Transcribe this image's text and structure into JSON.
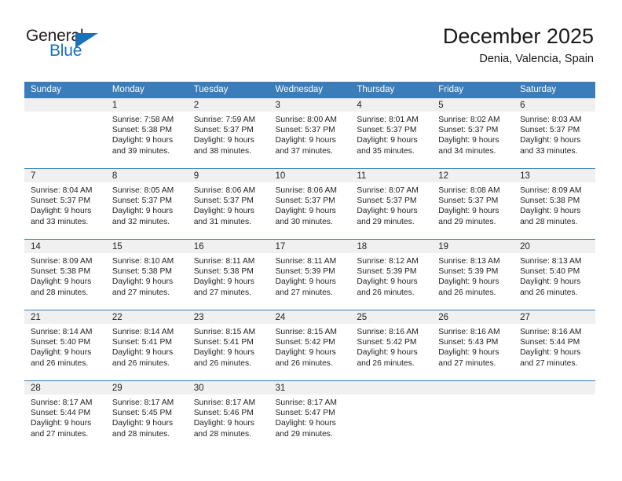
{
  "logo": {
    "word_one": "General",
    "word_two": "Blue",
    "triangle_icon": "triangle-icon",
    "brand_color": "#1b71b8"
  },
  "header": {
    "title": "December 2025",
    "subtitle": "Denia, Valencia, Spain"
  },
  "theme": {
    "header_blue": "#3b7dba",
    "daynum_band": "#f0f0f0",
    "text": "#222222"
  },
  "weekday_headers": [
    "Sunday",
    "Monday",
    "Tuesday",
    "Wednesday",
    "Thursday",
    "Friday",
    "Saturday"
  ],
  "weeks": [
    [
      {
        "day": "",
        "sunrise": "",
        "sunset": "",
        "daylight_line1": "",
        "daylight_line2": ""
      },
      {
        "day": "1",
        "sunrise": "Sunrise: 7:58 AM",
        "sunset": "Sunset: 5:38 PM",
        "daylight_line1": "Daylight: 9 hours",
        "daylight_line2": "and 39 minutes."
      },
      {
        "day": "2",
        "sunrise": "Sunrise: 7:59 AM",
        "sunset": "Sunset: 5:37 PM",
        "daylight_line1": "Daylight: 9 hours",
        "daylight_line2": "and 38 minutes."
      },
      {
        "day": "3",
        "sunrise": "Sunrise: 8:00 AM",
        "sunset": "Sunset: 5:37 PM",
        "daylight_line1": "Daylight: 9 hours",
        "daylight_line2": "and 37 minutes."
      },
      {
        "day": "4",
        "sunrise": "Sunrise: 8:01 AM",
        "sunset": "Sunset: 5:37 PM",
        "daylight_line1": "Daylight: 9 hours",
        "daylight_line2": "and 35 minutes."
      },
      {
        "day": "5",
        "sunrise": "Sunrise: 8:02 AM",
        "sunset": "Sunset: 5:37 PM",
        "daylight_line1": "Daylight: 9 hours",
        "daylight_line2": "and 34 minutes."
      },
      {
        "day": "6",
        "sunrise": "Sunrise: 8:03 AM",
        "sunset": "Sunset: 5:37 PM",
        "daylight_line1": "Daylight: 9 hours",
        "daylight_line2": "and 33 minutes."
      }
    ],
    [
      {
        "day": "7",
        "sunrise": "Sunrise: 8:04 AM",
        "sunset": "Sunset: 5:37 PM",
        "daylight_line1": "Daylight: 9 hours",
        "daylight_line2": "and 33 minutes."
      },
      {
        "day": "8",
        "sunrise": "Sunrise: 8:05 AM",
        "sunset": "Sunset: 5:37 PM",
        "daylight_line1": "Daylight: 9 hours",
        "daylight_line2": "and 32 minutes."
      },
      {
        "day": "9",
        "sunrise": "Sunrise: 8:06 AM",
        "sunset": "Sunset: 5:37 PM",
        "daylight_line1": "Daylight: 9 hours",
        "daylight_line2": "and 31 minutes."
      },
      {
        "day": "10",
        "sunrise": "Sunrise: 8:06 AM",
        "sunset": "Sunset: 5:37 PM",
        "daylight_line1": "Daylight: 9 hours",
        "daylight_line2": "and 30 minutes."
      },
      {
        "day": "11",
        "sunrise": "Sunrise: 8:07 AM",
        "sunset": "Sunset: 5:37 PM",
        "daylight_line1": "Daylight: 9 hours",
        "daylight_line2": "and 29 minutes."
      },
      {
        "day": "12",
        "sunrise": "Sunrise: 8:08 AM",
        "sunset": "Sunset: 5:37 PM",
        "daylight_line1": "Daylight: 9 hours",
        "daylight_line2": "and 29 minutes."
      },
      {
        "day": "13",
        "sunrise": "Sunrise: 8:09 AM",
        "sunset": "Sunset: 5:38 PM",
        "daylight_line1": "Daylight: 9 hours",
        "daylight_line2": "and 28 minutes."
      }
    ],
    [
      {
        "day": "14",
        "sunrise": "Sunrise: 8:09 AM",
        "sunset": "Sunset: 5:38 PM",
        "daylight_line1": "Daylight: 9 hours",
        "daylight_line2": "and 28 minutes."
      },
      {
        "day": "15",
        "sunrise": "Sunrise: 8:10 AM",
        "sunset": "Sunset: 5:38 PM",
        "daylight_line1": "Daylight: 9 hours",
        "daylight_line2": "and 27 minutes."
      },
      {
        "day": "16",
        "sunrise": "Sunrise: 8:11 AM",
        "sunset": "Sunset: 5:38 PM",
        "daylight_line1": "Daylight: 9 hours",
        "daylight_line2": "and 27 minutes."
      },
      {
        "day": "17",
        "sunrise": "Sunrise: 8:11 AM",
        "sunset": "Sunset: 5:39 PM",
        "daylight_line1": "Daylight: 9 hours",
        "daylight_line2": "and 27 minutes."
      },
      {
        "day": "18",
        "sunrise": "Sunrise: 8:12 AM",
        "sunset": "Sunset: 5:39 PM",
        "daylight_line1": "Daylight: 9 hours",
        "daylight_line2": "and 26 minutes."
      },
      {
        "day": "19",
        "sunrise": "Sunrise: 8:13 AM",
        "sunset": "Sunset: 5:39 PM",
        "daylight_line1": "Daylight: 9 hours",
        "daylight_line2": "and 26 minutes."
      },
      {
        "day": "20",
        "sunrise": "Sunrise: 8:13 AM",
        "sunset": "Sunset: 5:40 PM",
        "daylight_line1": "Daylight: 9 hours",
        "daylight_line2": "and 26 minutes."
      }
    ],
    [
      {
        "day": "21",
        "sunrise": "Sunrise: 8:14 AM",
        "sunset": "Sunset: 5:40 PM",
        "daylight_line1": "Daylight: 9 hours",
        "daylight_line2": "and 26 minutes."
      },
      {
        "day": "22",
        "sunrise": "Sunrise: 8:14 AM",
        "sunset": "Sunset: 5:41 PM",
        "daylight_line1": "Daylight: 9 hours",
        "daylight_line2": "and 26 minutes."
      },
      {
        "day": "23",
        "sunrise": "Sunrise: 8:15 AM",
        "sunset": "Sunset: 5:41 PM",
        "daylight_line1": "Daylight: 9 hours",
        "daylight_line2": "and 26 minutes."
      },
      {
        "day": "24",
        "sunrise": "Sunrise: 8:15 AM",
        "sunset": "Sunset: 5:42 PM",
        "daylight_line1": "Daylight: 9 hours",
        "daylight_line2": "and 26 minutes."
      },
      {
        "day": "25",
        "sunrise": "Sunrise: 8:16 AM",
        "sunset": "Sunset: 5:42 PM",
        "daylight_line1": "Daylight: 9 hours",
        "daylight_line2": "and 26 minutes."
      },
      {
        "day": "26",
        "sunrise": "Sunrise: 8:16 AM",
        "sunset": "Sunset: 5:43 PM",
        "daylight_line1": "Daylight: 9 hours",
        "daylight_line2": "and 27 minutes."
      },
      {
        "day": "27",
        "sunrise": "Sunrise: 8:16 AM",
        "sunset": "Sunset: 5:44 PM",
        "daylight_line1": "Daylight: 9 hours",
        "daylight_line2": "and 27 minutes."
      }
    ],
    [
      {
        "day": "28",
        "sunrise": "Sunrise: 8:17 AM",
        "sunset": "Sunset: 5:44 PM",
        "daylight_line1": "Daylight: 9 hours",
        "daylight_line2": "and 27 minutes."
      },
      {
        "day": "29",
        "sunrise": "Sunrise: 8:17 AM",
        "sunset": "Sunset: 5:45 PM",
        "daylight_line1": "Daylight: 9 hours",
        "daylight_line2": "and 28 minutes."
      },
      {
        "day": "30",
        "sunrise": "Sunrise: 8:17 AM",
        "sunset": "Sunset: 5:46 PM",
        "daylight_line1": "Daylight: 9 hours",
        "daylight_line2": "and 28 minutes."
      },
      {
        "day": "31",
        "sunrise": "Sunrise: 8:17 AM",
        "sunset": "Sunset: 5:47 PM",
        "daylight_line1": "Daylight: 9 hours",
        "daylight_line2": "and 29 minutes."
      },
      {
        "day": "",
        "sunrise": "",
        "sunset": "",
        "daylight_line1": "",
        "daylight_line2": ""
      },
      {
        "day": "",
        "sunrise": "",
        "sunset": "",
        "daylight_line1": "",
        "daylight_line2": ""
      },
      {
        "day": "",
        "sunrise": "",
        "sunset": "",
        "daylight_line1": "",
        "daylight_line2": ""
      }
    ]
  ]
}
